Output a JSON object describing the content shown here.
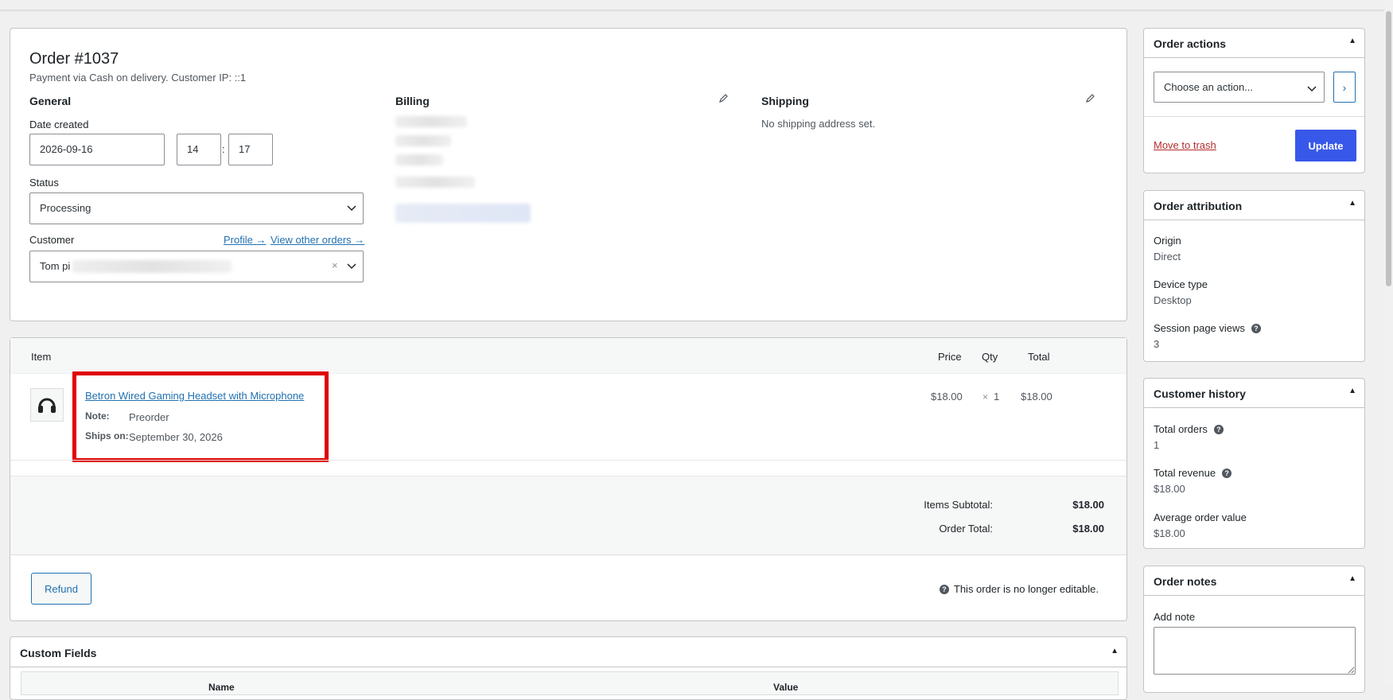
{
  "order": {
    "title": "Order #1037",
    "subtitle": "Payment via Cash on delivery. Customer IP: ::1",
    "general_heading": "General",
    "date_created_label": "Date created",
    "date_value": "2026-09-16",
    "hour_value": "14",
    "minute_value": "17",
    "time_separator": ":",
    "status_label": "Status",
    "status_value": "Processing",
    "customer_label": "Customer",
    "profile_link": "Profile →",
    "view_orders_link": "View other orders →",
    "customer_value": "Tom pi",
    "billing_heading": "Billing",
    "shipping_heading": "Shipping",
    "shipping_text": "No shipping address set."
  },
  "items": {
    "headers": {
      "item": "Item",
      "price": "Price",
      "qty": "Qty",
      "total": "Total"
    },
    "rows": [
      {
        "name": "Betron Wired Gaming Headset with Microphone",
        "note_label": "Note:",
        "note_value": "Preorder",
        "ships_label": "Ships on:",
        "ships_value": "September 30, 2026",
        "price": "$18.00",
        "qty_prefix": "×",
        "qty": "1",
        "total": "$18.00"
      }
    ],
    "subtotal_label": "Items Subtotal:",
    "subtotal_value": "$18.00",
    "order_total_label": "Order Total:",
    "order_total_value": "$18.00",
    "refund_label": "Refund",
    "not_editable": "This order is no longer editable."
  },
  "custom_fields": {
    "title": "Custom Fields",
    "col_name": "Name",
    "col_value": "Value"
  },
  "actions": {
    "title": "Order actions",
    "select_placeholder": "Choose an action...",
    "trash_label": "Move to trash",
    "update_label": "Update"
  },
  "attribution": {
    "title": "Order attribution",
    "origin_label": "Origin",
    "origin_value": "Direct",
    "device_label": "Device type",
    "device_value": "Desktop",
    "views_label": "Session page views",
    "views_value": "3"
  },
  "history": {
    "title": "Customer history",
    "orders_label": "Total orders",
    "orders_value": "1",
    "revenue_label": "Total revenue",
    "revenue_value": "$18.00",
    "aov_label": "Average order value",
    "aov_value": "$18.00"
  },
  "notes": {
    "title": "Order notes",
    "add_note_label": "Add note"
  },
  "colors": {
    "accent": "#2271b1",
    "button_primary": "#3858e9",
    "highlight": "#e00000",
    "trash": "#b32d2e"
  }
}
